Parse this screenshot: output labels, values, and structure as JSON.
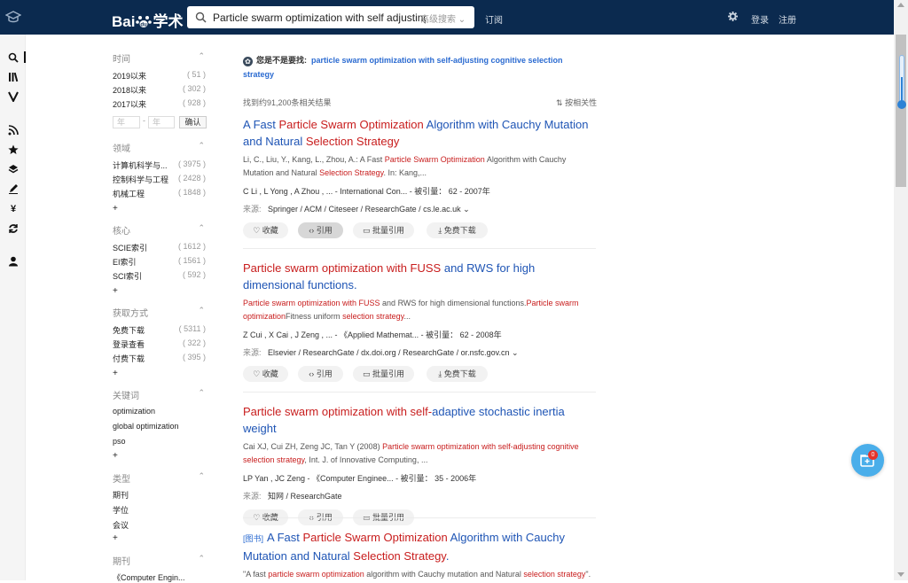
{
  "header": {
    "brand_pre": "Bai",
    "brand_post": "学术",
    "search_value": "Particle swarm optimization with self adjusting",
    "advanced_search": "高级搜索",
    "subscribe": "订阅",
    "login": "登录",
    "register": "注册"
  },
  "facets": {
    "time": {
      "title": "时间",
      "items": [
        {
          "label": "2019以来",
          "count": "( 51 )"
        },
        {
          "label": "2018以来",
          "count": "( 302 )"
        },
        {
          "label": "2017以来",
          "count": "( 928 )"
        }
      ],
      "year_placeholder": "年",
      "dash": "-",
      "confirm": "确认"
    },
    "field": {
      "title": "领域",
      "items": [
        {
          "label": "计算机科学与...",
          "count": "( 3975 )"
        },
        {
          "label": "控制科学与工程",
          "count": "( 2428 )"
        },
        {
          "label": "机械工程",
          "count": "( 1848 )"
        }
      ]
    },
    "core": {
      "title": "核心",
      "items": [
        {
          "label": "SCIE索引",
          "count": "( 1612 )"
        },
        {
          "label": "EI索引",
          "count": "( 1561 )"
        },
        {
          "label": "SCI索引",
          "count": "( 592 )"
        }
      ]
    },
    "access": {
      "title": "获取方式",
      "items": [
        {
          "label": "免费下载",
          "count": "( 5311 )"
        },
        {
          "label": "登录查看",
          "count": "( 322 )"
        },
        {
          "label": "付费下载",
          "count": "( 395 )"
        }
      ]
    },
    "keywords": {
      "title": "关键词",
      "items": [
        "optimization",
        "global optimization",
        "pso"
      ]
    },
    "type": {
      "title": "类型",
      "items": [
        "期刊",
        "学位",
        "会议"
      ]
    },
    "journal": {
      "title": "期刊",
      "items": [
        "《Computer Engin..."
      ]
    },
    "plus": "+"
  },
  "results": {
    "dym_label": "您是不是要找:",
    "dym_link": "particle swarm optimization with self-adjusting cognitive selection strategy",
    "found": "找到约91,200条相关结果",
    "sort": "按相关性",
    "actions": {
      "collect": "收藏",
      "cite": "引用",
      "batch": "批量引用",
      "download": "免费下载"
    },
    "source_label": "来源:",
    "items": [
      {
        "t1": "A Fast ",
        "t2": "Particle Swarm Optimization",
        "t3": " Algorithm with Cauchy Mutation and Natural ",
        "t4": "Selection Strategy",
        "ab1": "Li, C., Liu, Y., Kang, L., Zhou, A.: A Fast ",
        "ab2": "Particle Swarm Optimization",
        "ab3": " Algorithm with Cauchy Mutation and Natural ",
        "ab4": "Selection Strategy",
        "ab5": ". In: Kang,...",
        "meta": "C Li ,    L Yong ,    A Zhou ,    ...  -  International Con...  -  被引量：  62  -  2007年",
        "sources": "Springer  /  ACM  /  Citeseer  /  ResearchGate  /  cs.le.ac.uk"
      },
      {
        "t1": "Particle swarm optimization with FUSS",
        "t2": " and RWS for high dimensional functions.",
        "ab1": "Particle swarm optimization with FUSS",
        "ab2": " and RWS for high dimensional functions.",
        "ab3": "Particle swarm optimization",
        "ab4": "Fitness uniform ",
        "ab5": "selection strategy",
        "ab6": "...",
        "meta": "Z Cui ,    X Cai ,    J Zeng ,    ...  -  《Applied Mathemat...  -  被引量：  62  -  2008年",
        "sources": "Elsevier  /  ResearchGate  /  dx.doi.org  /  ResearchGate  /  or.nsfc.gov.cn"
      },
      {
        "t1": "Particle swarm optimization with self-",
        "t2": "adaptive stochastic inertia weight",
        "ab1": "Cai XJ, Cui ZH, Zeng JC, Tan Y (2008) ",
        "ab2": "Particle swarm optimization with self-adjusting cognitive selection strategy",
        "ab3": ", Int. J. of Innovative Computing, ...",
        "meta": "LP Yan ,    JC Zeng  -  《Computer Enginee...  -  被引量：  35  -  2006年",
        "sources": "知网  /  ResearchGate"
      },
      {
        "tag": "[图书]",
        "t1": "A Fast ",
        "t2": "Particle Swarm Optimization",
        "t3": " Algorithm with Cauchy Mutation and Natural ",
        "t4": "Selection Strategy",
        "t5": ".",
        "ab1": "\"A fast ",
        "ab2": "particle swarm optimization",
        "ab3": " algorithm with Cauchy mutation and Natural ",
        "ab4": "selection strategy",
        "ab5": "\"."
      }
    ]
  },
  "widget": {
    "badge": "0"
  }
}
